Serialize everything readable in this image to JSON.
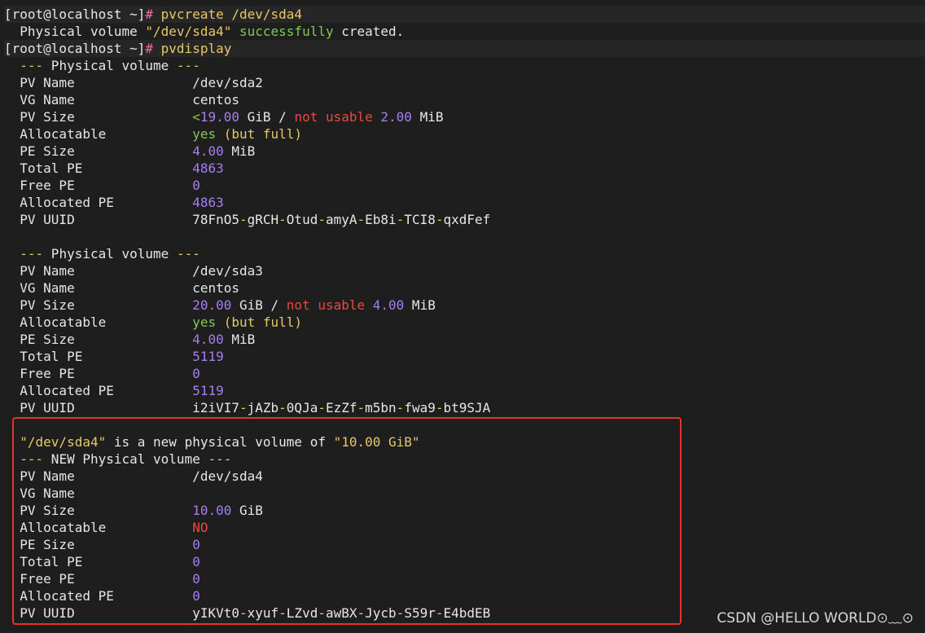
{
  "colors": {
    "default": "#e6e6e6",
    "pink": "#f06b9f",
    "yellow": "#e6c86a",
    "green": "#7fca54",
    "purple": "#a77ef0",
    "red": "#e84a3f"
  },
  "lines": [
    {
      "prompt": true,
      "segs": [
        {
          "t": "[root@localhost ~]"
        },
        {
          "t": "# ",
          "c": "pink"
        },
        {
          "t": "pvcreate /dev/sda4",
          "c": "yellow"
        }
      ]
    },
    {
      "segs": [
        {
          "t": "  Physical volume "
        },
        {
          "t": "\"/dev/sda4\"",
          "c": "yellow"
        },
        {
          "t": " "
        },
        {
          "t": "successfully",
          "c": "green"
        },
        {
          "t": " created."
        }
      ]
    },
    {
      "prompt": true,
      "segs": [
        {
          "t": "[root@localhost ~]"
        },
        {
          "t": "# ",
          "c": "pink"
        },
        {
          "t": "pvdisplay",
          "c": "yellow"
        }
      ]
    },
    {
      "segs": [
        {
          "t": "  "
        },
        {
          "t": "---",
          "c": "yellow"
        },
        {
          "t": " Physical volume "
        },
        {
          "t": "---",
          "c": "yellow"
        }
      ]
    },
    {
      "segs": [
        {
          "t": "  PV Name               /dev/sda2"
        }
      ]
    },
    {
      "segs": [
        {
          "t": "  VG Name               centos"
        }
      ]
    },
    {
      "segs": [
        {
          "t": "  PV Size               "
        },
        {
          "t": "<",
          "c": "green"
        },
        {
          "t": "19.00",
          "c": "purple"
        },
        {
          "t": " GiB / "
        },
        {
          "t": "not usable",
          "c": "red"
        },
        {
          "t": " "
        },
        {
          "t": "2.00",
          "c": "purple"
        },
        {
          "t": " MiB"
        }
      ]
    },
    {
      "segs": [
        {
          "t": "  Allocatable           "
        },
        {
          "t": "yes",
          "c": "green"
        },
        {
          "t": " "
        },
        {
          "t": "(but full)",
          "c": "yellow"
        }
      ]
    },
    {
      "segs": [
        {
          "t": "  PE Size               "
        },
        {
          "t": "4.00",
          "c": "purple"
        },
        {
          "t": " MiB"
        }
      ]
    },
    {
      "segs": [
        {
          "t": "  Total PE              "
        },
        {
          "t": "4863",
          "c": "purple"
        }
      ]
    },
    {
      "segs": [
        {
          "t": "  Free PE               "
        },
        {
          "t": "0",
          "c": "purple"
        }
      ]
    },
    {
      "segs": [
        {
          "t": "  Allocated PE          "
        },
        {
          "t": "4863",
          "c": "purple"
        }
      ]
    },
    {
      "segs": [
        {
          "t": "  PV UUID               78FnO5"
        },
        {
          "t": "-",
          "c": "yellow"
        },
        {
          "t": "gRCH"
        },
        {
          "t": "-",
          "c": "yellow"
        },
        {
          "t": "Otud"
        },
        {
          "t": "-",
          "c": "yellow"
        },
        {
          "t": "amyA"
        },
        {
          "t": "-",
          "c": "yellow"
        },
        {
          "t": "Eb8i"
        },
        {
          "t": "-",
          "c": "yellow"
        },
        {
          "t": "TCI8"
        },
        {
          "t": "-",
          "c": "yellow"
        },
        {
          "t": "qxdFef"
        }
      ]
    },
    {
      "segs": [
        {
          "t": ""
        }
      ]
    },
    {
      "segs": [
        {
          "t": "  "
        },
        {
          "t": "---",
          "c": "yellow"
        },
        {
          "t": " Physical volume "
        },
        {
          "t": "---",
          "c": "yellow"
        }
      ]
    },
    {
      "segs": [
        {
          "t": "  PV Name               /dev/sda3"
        }
      ]
    },
    {
      "segs": [
        {
          "t": "  VG Name               centos"
        }
      ]
    },
    {
      "segs": [
        {
          "t": "  PV Size               "
        },
        {
          "t": "20.00",
          "c": "purple"
        },
        {
          "t": " GiB / "
        },
        {
          "t": "not usable",
          "c": "red"
        },
        {
          "t": " "
        },
        {
          "t": "4.00",
          "c": "purple"
        },
        {
          "t": " MiB"
        }
      ]
    },
    {
      "segs": [
        {
          "t": "  Allocatable           "
        },
        {
          "t": "yes",
          "c": "green"
        },
        {
          "t": " "
        },
        {
          "t": "(but full)",
          "c": "yellow"
        }
      ]
    },
    {
      "segs": [
        {
          "t": "  PE Size               "
        },
        {
          "t": "4.00",
          "c": "purple"
        },
        {
          "t": " MiB"
        }
      ]
    },
    {
      "segs": [
        {
          "t": "  Total PE              "
        },
        {
          "t": "5119",
          "c": "purple"
        }
      ]
    },
    {
      "segs": [
        {
          "t": "  Free PE               "
        },
        {
          "t": "0",
          "c": "purple"
        }
      ]
    },
    {
      "segs": [
        {
          "t": "  Allocated PE          "
        },
        {
          "t": "5119",
          "c": "purple"
        }
      ]
    },
    {
      "segs": [
        {
          "t": "  PV UUID               i2iVI7"
        },
        {
          "t": "-",
          "c": "yellow"
        },
        {
          "t": "jAZb"
        },
        {
          "t": "-",
          "c": "yellow"
        },
        {
          "t": "0QJa"
        },
        {
          "t": "-",
          "c": "yellow"
        },
        {
          "t": "EzZf"
        },
        {
          "t": "-",
          "c": "yellow"
        },
        {
          "t": "m5bn"
        },
        {
          "t": "-",
          "c": "yellow"
        },
        {
          "t": "fwa9"
        },
        {
          "t": "-",
          "c": "yellow"
        },
        {
          "t": "bt9SJA"
        }
      ]
    },
    {
      "segs": [
        {
          "t": ""
        }
      ]
    },
    {
      "segs": [
        {
          "t": "  "
        },
        {
          "t": "\"/dev/sda4\"",
          "c": "yellow"
        },
        {
          "t": " is a new physical volume of "
        },
        {
          "t": "\"10.00 GiB\"",
          "c": "yellow"
        }
      ]
    },
    {
      "segs": [
        {
          "t": "  "
        },
        {
          "t": "---",
          "c": "yellow"
        },
        {
          "t": " NEW Physical volume "
        },
        {
          "t": "---",
          "c": "yellow"
        }
      ]
    },
    {
      "segs": [
        {
          "t": "  PV Name               /dev/sda4"
        }
      ]
    },
    {
      "segs": [
        {
          "t": "  VG Name"
        }
      ]
    },
    {
      "segs": [
        {
          "t": "  PV Size               "
        },
        {
          "t": "10.00",
          "c": "purple"
        },
        {
          "t": " GiB"
        }
      ]
    },
    {
      "segs": [
        {
          "t": "  Allocatable           "
        },
        {
          "t": "NO",
          "c": "red"
        }
      ]
    },
    {
      "segs": [
        {
          "t": "  PE Size               "
        },
        {
          "t": "0",
          "c": "purple"
        }
      ]
    },
    {
      "segs": [
        {
          "t": "  Total PE              "
        },
        {
          "t": "0",
          "c": "purple"
        }
      ]
    },
    {
      "segs": [
        {
          "t": "  Free PE               "
        },
        {
          "t": "0",
          "c": "purple"
        }
      ]
    },
    {
      "segs": [
        {
          "t": "  Allocated PE          "
        },
        {
          "t": "0",
          "c": "purple"
        }
      ]
    },
    {
      "segs": [
        {
          "t": "  PV UUID               yIKVt0"
        },
        {
          "t": "-",
          "c": "yellow"
        },
        {
          "t": "xyuf"
        },
        {
          "t": "-",
          "c": "yellow"
        },
        {
          "t": "LZvd"
        },
        {
          "t": "-",
          "c": "yellow"
        },
        {
          "t": "awBX"
        },
        {
          "t": "-",
          "c": "yellow"
        },
        {
          "t": "Jycb"
        },
        {
          "t": "-",
          "c": "yellow"
        },
        {
          "t": "S59r"
        },
        {
          "t": "-",
          "c": "yellow"
        },
        {
          "t": "E4bdEB"
        }
      ]
    }
  ],
  "watermark": "CSDN @HELLO WORLD⊙﹏⊙"
}
